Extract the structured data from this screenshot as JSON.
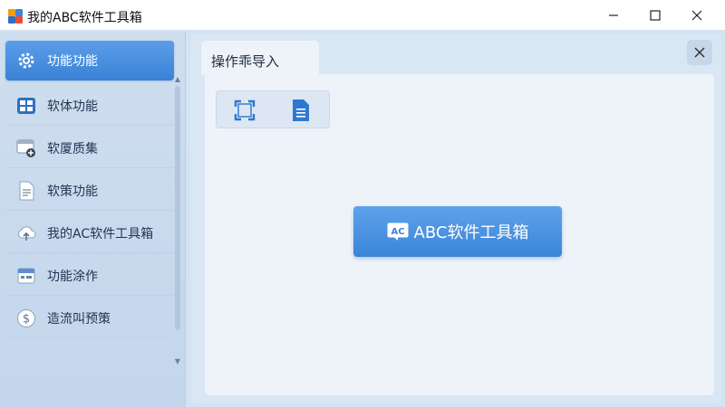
{
  "window": {
    "title": "我的ABC软件工具箱",
    "minimize_icon": "minimize-icon",
    "maximize_icon": "maximize-icon",
    "close_icon": "close-icon"
  },
  "sidebar": {
    "items": [
      {
        "label": "功能功能",
        "icon": "gear-icon",
        "active": true
      },
      {
        "label": "软体功能",
        "icon": "grid-icon",
        "active": false
      },
      {
        "label": "软厦质集",
        "icon": "window-add-icon",
        "active": false
      },
      {
        "label": "软策功能",
        "icon": "document-icon",
        "active": false
      },
      {
        "label": "我的AC软件工具箱",
        "icon": "cloud-upload-icon",
        "active": false
      },
      {
        "label": "功能涂作",
        "icon": "calendar-icon",
        "active": false
      },
      {
        "label": "造流叫预策",
        "icon": "dollar-icon",
        "active": false
      }
    ]
  },
  "main": {
    "tab_label": "操作乖导入",
    "toolbar": {
      "crop_icon": "crop-icon",
      "doc_icon": "document-list-icon"
    },
    "button": {
      "badge": "AC",
      "label": "ABC软件工具箱"
    }
  },
  "colors": {
    "accent": "#3b84d8",
    "sidebar_bg": "#c9dbee",
    "panel_bg": "#eef3fa"
  }
}
